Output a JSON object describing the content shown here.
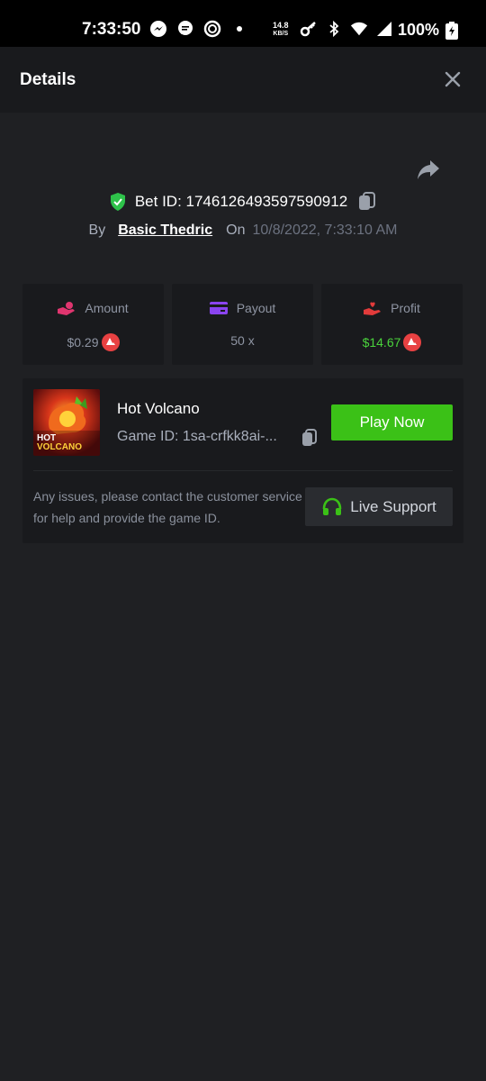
{
  "status_bar": {
    "time": "7:33:50",
    "speed_value": "14.8",
    "speed_unit": "KB/S",
    "battery": "100%"
  },
  "header": {
    "title": "Details"
  },
  "bet": {
    "id_label": "Bet ID: 1746126493597590912",
    "by_label": "By",
    "user": "Basic Thedric",
    "on_label": "On",
    "date": "10/8/2022, 7:33:10 AM"
  },
  "stats": {
    "amount": {
      "label": "Amount",
      "value": "$0.29"
    },
    "payout": {
      "label": "Payout",
      "value": "50 x"
    },
    "profit": {
      "label": "Profit",
      "value": "$14.67"
    }
  },
  "game": {
    "thumb_text_line1": "HOT",
    "thumb_text_line2": "VOLCANO",
    "name": "Hot Volcano",
    "id_label": "Game ID: 1sa-crfkk8ai-...",
    "play_label": "Play Now",
    "support_text": "Any issues, please contact the customer service for help and provide the game ID.",
    "live_support_label": "Live Support"
  },
  "colors": {
    "accent_green": "#3bc117",
    "profit_green": "#4ad33c",
    "coin_red": "#e84142"
  },
  "icons": {
    "close": "close-icon",
    "share": "share-icon",
    "shield": "shield-check-icon",
    "copy": "copy-icon",
    "amount": "hand-coin-icon",
    "payout": "card-icon",
    "profit": "hand-heart-icon",
    "coin": "avax-coin-icon",
    "headset": "headset-icon"
  }
}
